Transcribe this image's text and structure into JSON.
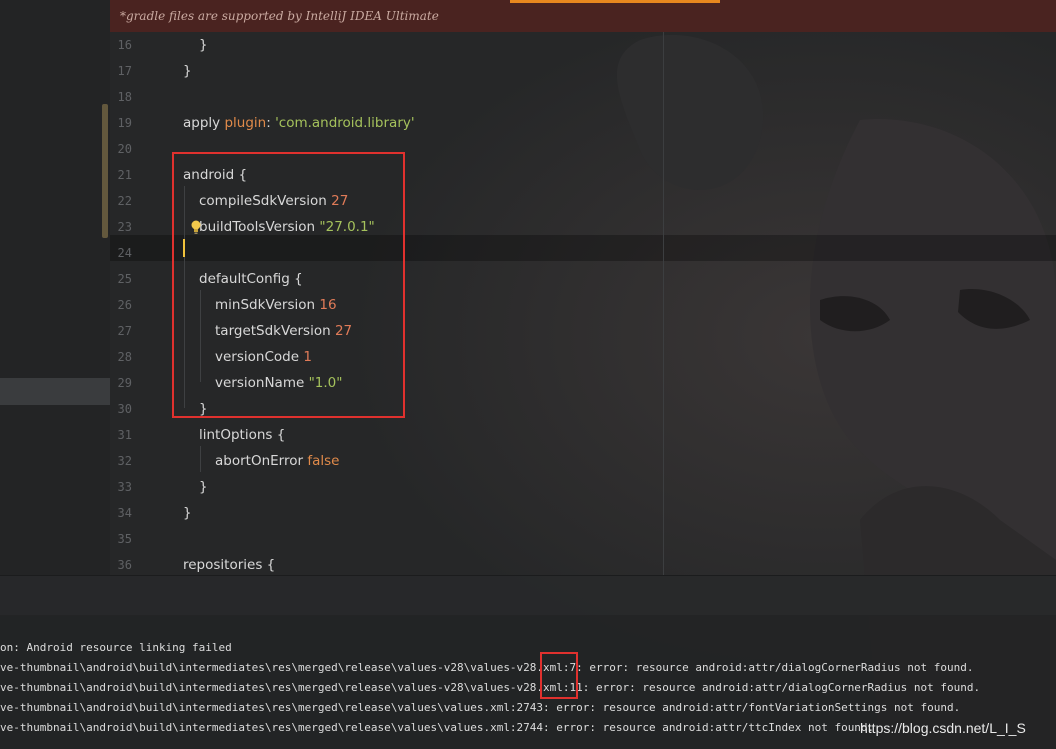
{
  "notice_bar": {
    "text": "*gradle files are supported by IntelliJ IDEA Ultimate"
  },
  "editor": {
    "caret_line": 24,
    "lightbulb_line": 23,
    "line_numbers": [
      "16",
      "17",
      "18",
      "19",
      "20",
      "21",
      "22",
      "23",
      "24",
      "25",
      "26",
      "27",
      "28",
      "29",
      "30",
      "31",
      "32",
      "33",
      "34",
      "35",
      "36"
    ],
    "lines": [
      {
        "num": "16",
        "indent": 1,
        "tokens": [
          {
            "t": "}",
            "c": "plain"
          }
        ]
      },
      {
        "num": "17",
        "indent": 0,
        "tokens": [
          {
            "t": "}",
            "c": "plain"
          }
        ]
      },
      {
        "num": "18",
        "indent": 0,
        "tokens": []
      },
      {
        "num": "19",
        "indent": 0,
        "tokens": [
          {
            "t": "apply ",
            "c": "plain"
          },
          {
            "t": "plugin",
            "c": "kw"
          },
          {
            "t": ": ",
            "c": "plain"
          },
          {
            "t": "'com.android.library'",
            "c": "str"
          }
        ]
      },
      {
        "num": "20",
        "indent": 0,
        "tokens": []
      },
      {
        "num": "21",
        "indent": 0,
        "tokens": [
          {
            "t": "android {",
            "c": "plain"
          }
        ]
      },
      {
        "num": "22",
        "indent": 1,
        "tokens": [
          {
            "t": "compileSdkVersion ",
            "c": "plain"
          },
          {
            "t": "27",
            "c": "num"
          }
        ]
      },
      {
        "num": "23",
        "indent": 1,
        "tokens": [
          {
            "t": "buildToolsVersion ",
            "c": "plain"
          },
          {
            "t": "\"27.0.1\"",
            "c": "str"
          }
        ]
      },
      {
        "num": "24",
        "indent": 0,
        "tokens": []
      },
      {
        "num": "25",
        "indent": 1,
        "tokens": [
          {
            "t": "defaultConfig {",
            "c": "plain"
          }
        ]
      },
      {
        "num": "26",
        "indent": 2,
        "tokens": [
          {
            "t": "minSdkVersion ",
            "c": "plain"
          },
          {
            "t": "16",
            "c": "num"
          }
        ]
      },
      {
        "num": "27",
        "indent": 2,
        "tokens": [
          {
            "t": "targetSdkVersion ",
            "c": "plain"
          },
          {
            "t": "27",
            "c": "num"
          }
        ]
      },
      {
        "num": "28",
        "indent": 2,
        "tokens": [
          {
            "t": "versionCode ",
            "c": "plain"
          },
          {
            "t": "1",
            "c": "num"
          }
        ]
      },
      {
        "num": "29",
        "indent": 2,
        "tokens": [
          {
            "t": "versionName ",
            "c": "plain"
          },
          {
            "t": "\"1.0\"",
            "c": "str"
          }
        ]
      },
      {
        "num": "30",
        "indent": 1,
        "tokens": [
          {
            "t": "}",
            "c": "plain"
          }
        ]
      },
      {
        "num": "31",
        "indent": 1,
        "tokens": [
          {
            "t": "lintOptions {",
            "c": "plain"
          }
        ]
      },
      {
        "num": "32",
        "indent": 2,
        "tokens": [
          {
            "t": "abortOnError ",
            "c": "plain"
          },
          {
            "t": "false",
            "c": "kw"
          }
        ]
      },
      {
        "num": "33",
        "indent": 1,
        "tokens": [
          {
            "t": "}",
            "c": "plain"
          }
        ]
      },
      {
        "num": "34",
        "indent": 0,
        "tokens": [
          {
            "t": "}",
            "c": "plain"
          }
        ]
      },
      {
        "num": "35",
        "indent": 0,
        "tokens": []
      },
      {
        "num": "36",
        "indent": 0,
        "tokens": [
          {
            "t": "repositories {",
            "c": "plain"
          }
        ]
      }
    ]
  },
  "console": {
    "lines": [
      "on: Android resource linking failed",
      "ve-thumbnail\\android\\build\\intermediates\\res\\merged\\release\\values-v28\\values-v28.xml:7: error: resource android:attr/dialogCornerRadius not found.",
      "ve-thumbnail\\android\\build\\intermediates\\res\\merged\\release\\values-v28\\values-v28.xml:11: error: resource android:attr/dialogCornerRadius not found.",
      "ve-thumbnail\\android\\build\\intermediates\\res\\merged\\release\\values\\values.xml:2743: error: resource android:attr/fontVariationSettings not found.",
      "ve-thumbnail\\android\\build\\intermediates\\res\\merged\\release\\values\\values.xml:2744: error: resource android:attr/ttcIndex not found."
    ]
  },
  "watermark": "https://blog.csdn.net/L_I_S",
  "icons": {
    "lightbulb": "lightbulb-icon"
  },
  "colors": {
    "background": "#262728",
    "notice_bar": "#4a2320",
    "string": "#a5c25c",
    "number": "#e07b58",
    "keyword": "#e08a4a",
    "annotation_box": "#e0312e",
    "caret": "#f0c23c"
  }
}
